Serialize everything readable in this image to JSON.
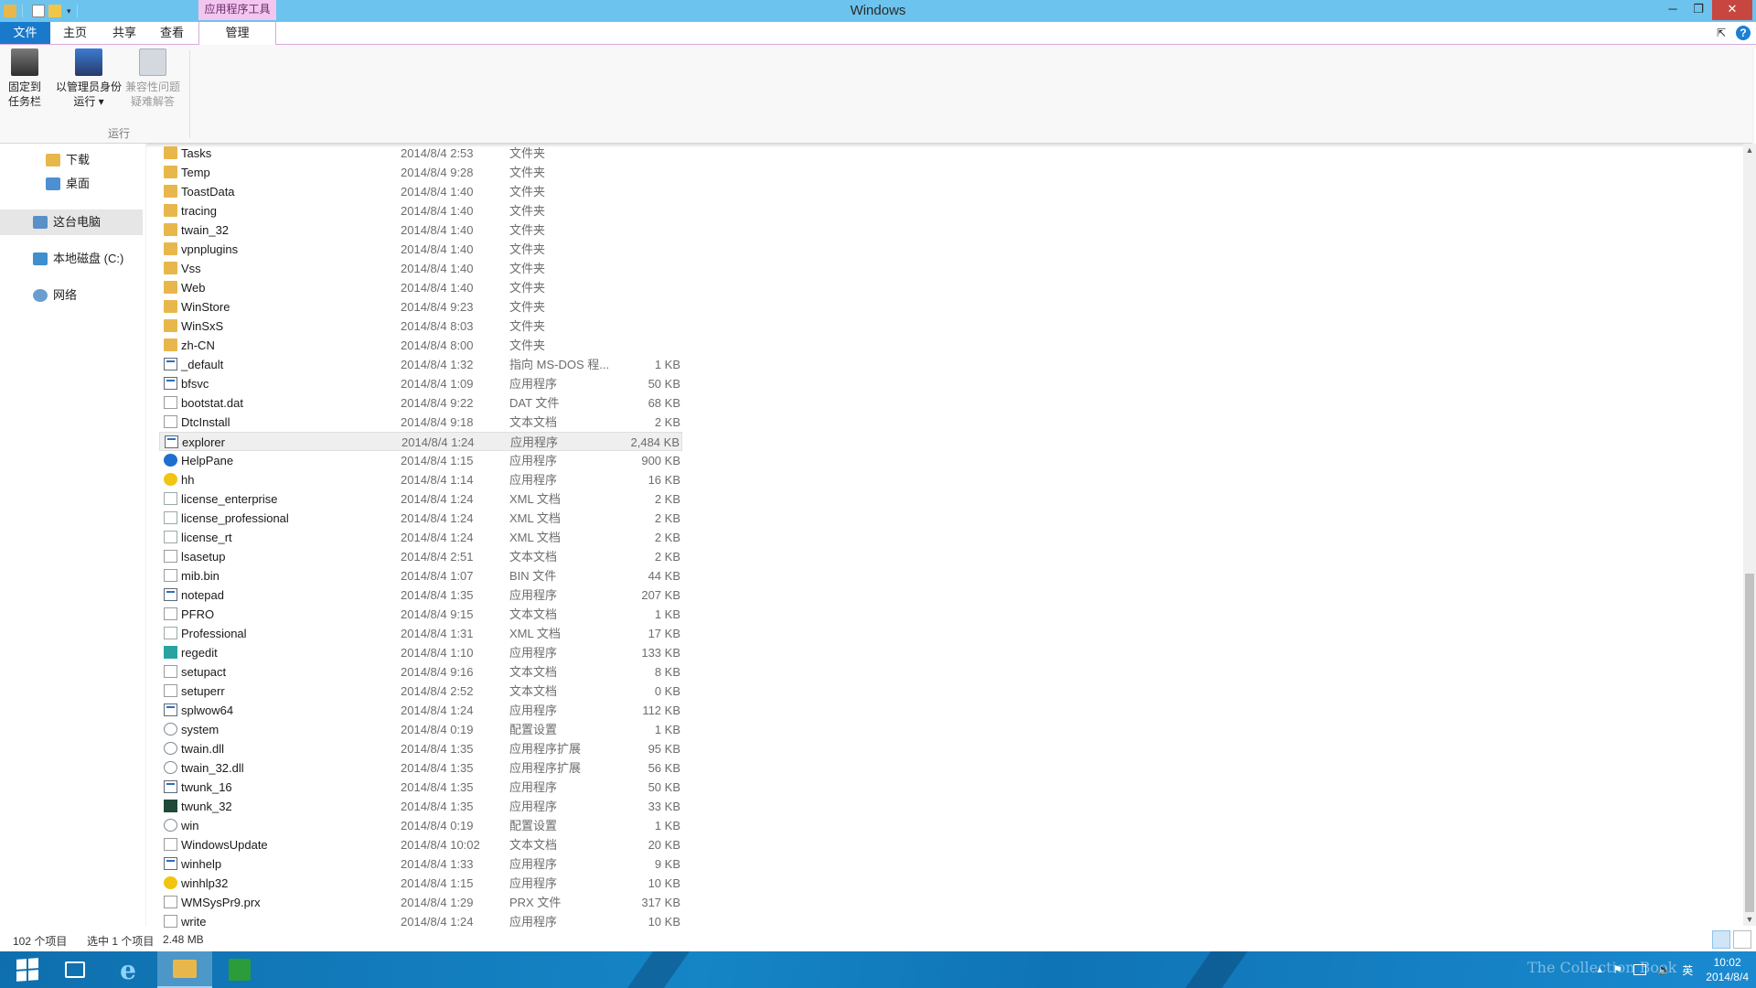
{
  "window": {
    "title": "Windows",
    "context_tab": "应用程序工具",
    "minimize": "─",
    "restore": "❐",
    "close": "✕"
  },
  "ribbon_tabs": {
    "file": "文件",
    "home": "主页",
    "share": "共享",
    "view": "查看",
    "manage": "管理"
  },
  "ribbon": {
    "pin_label": "固定到\n任务栏",
    "run_as_admin_label": "以管理员身份\n运行 ▾",
    "compat_label": "兼容性问题\n疑难解答",
    "group_label": "运行"
  },
  "nav": {
    "downloads": "下载",
    "desktop": "桌面",
    "this_pc": "这台电脑",
    "local_disk": "本地磁盘 (C:)",
    "network": "网络"
  },
  "files": [
    {
      "name": "Tasks",
      "date": "2014/8/4 2:53",
      "type": "文件夹",
      "size": "",
      "icon": "folder-icon"
    },
    {
      "name": "Temp",
      "date": "2014/8/4 9:28",
      "type": "文件夹",
      "size": "",
      "icon": "folder-icon"
    },
    {
      "name": "ToastData",
      "date": "2014/8/4 1:40",
      "type": "文件夹",
      "size": "",
      "icon": "folder-icon"
    },
    {
      "name": "tracing",
      "date": "2014/8/4 1:40",
      "type": "文件夹",
      "size": "",
      "icon": "folder-icon"
    },
    {
      "name": "twain_32",
      "date": "2014/8/4 1:40",
      "type": "文件夹",
      "size": "",
      "icon": "folder-icon"
    },
    {
      "name": "vpnplugins",
      "date": "2014/8/4 1:40",
      "type": "文件夹",
      "size": "",
      "icon": "folder-icon"
    },
    {
      "name": "Vss",
      "date": "2014/8/4 1:40",
      "type": "文件夹",
      "size": "",
      "icon": "folder-icon"
    },
    {
      "name": "Web",
      "date": "2014/8/4 1:40",
      "type": "文件夹",
      "size": "",
      "icon": "folder-icon"
    },
    {
      "name": "WinStore",
      "date": "2014/8/4 9:23",
      "type": "文件夹",
      "size": "",
      "icon": "folder-icon"
    },
    {
      "name": "WinSxS",
      "date": "2014/8/4 8:03",
      "type": "文件夹",
      "size": "",
      "icon": "folder-icon"
    },
    {
      "name": "zh-CN",
      "date": "2014/8/4 8:00",
      "type": "文件夹",
      "size": "",
      "icon": "folder-icon"
    },
    {
      "name": "_default",
      "date": "2014/8/4 1:32",
      "type": "指向 MS-DOS 程...",
      "size": "1 KB",
      "icon": "shortcut-icon"
    },
    {
      "name": "bfsvc",
      "date": "2014/8/4 1:09",
      "type": "应用程序",
      "size": "50 KB",
      "icon": "app-icon"
    },
    {
      "name": "bootstat.dat",
      "date": "2014/8/4 9:22",
      "type": "DAT 文件",
      "size": "68 KB",
      "icon": "file-icon"
    },
    {
      "name": "DtcInstall",
      "date": "2014/8/4 9:18",
      "type": "文本文档",
      "size": "2 KB",
      "icon": "text-file-icon"
    },
    {
      "name": "explorer",
      "date": "2014/8/4 1:24",
      "type": "应用程序",
      "size": "2,484 KB",
      "icon": "explorer-icon"
    },
    {
      "name": "HelpPane",
      "date": "2014/8/4 1:15",
      "type": "应用程序",
      "size": "900 KB",
      "icon": "help-icon"
    },
    {
      "name": "hh",
      "date": "2014/8/4 1:14",
      "type": "应用程序",
      "size": "16 KB",
      "icon": "help-file-icon"
    },
    {
      "name": "license_enterprise",
      "date": "2014/8/4 1:24",
      "type": "XML 文档",
      "size": "2 KB",
      "icon": "xml-icon"
    },
    {
      "name": "license_professional",
      "date": "2014/8/4 1:24",
      "type": "XML 文档",
      "size": "2 KB",
      "icon": "xml-icon"
    },
    {
      "name": "license_rt",
      "date": "2014/8/4 1:24",
      "type": "XML 文档",
      "size": "2 KB",
      "icon": "xml-icon"
    },
    {
      "name": "lsasetup",
      "date": "2014/8/4 2:51",
      "type": "文本文档",
      "size": "2 KB",
      "icon": "text-file-icon"
    },
    {
      "name": "mib.bin",
      "date": "2014/8/4 1:07",
      "type": "BIN 文件",
      "size": "44 KB",
      "icon": "file-icon"
    },
    {
      "name": "notepad",
      "date": "2014/8/4 1:35",
      "type": "应用程序",
      "size": "207 KB",
      "icon": "notepad-icon"
    },
    {
      "name": "PFRO",
      "date": "2014/8/4 9:15",
      "type": "文本文档",
      "size": "1 KB",
      "icon": "text-file-icon"
    },
    {
      "name": "Professional",
      "date": "2014/8/4 1:31",
      "type": "XML 文档",
      "size": "17 KB",
      "icon": "xml-icon"
    },
    {
      "name": "regedit",
      "date": "2014/8/4 1:10",
      "type": "应用程序",
      "size": "133 KB",
      "icon": "regedit-icon"
    },
    {
      "name": "setupact",
      "date": "2014/8/4 9:16",
      "type": "文本文档",
      "size": "8 KB",
      "icon": "text-file-icon"
    },
    {
      "name": "setuperr",
      "date": "2014/8/4 2:52",
      "type": "文本文档",
      "size": "0 KB",
      "icon": "text-file-icon"
    },
    {
      "name": "splwow64",
      "date": "2014/8/4 1:24",
      "type": "应用程序",
      "size": "112 KB",
      "icon": "printer-icon"
    },
    {
      "name": "system",
      "date": "2014/8/4 0:19",
      "type": "配置设置",
      "size": "1 KB",
      "icon": "config-icon"
    },
    {
      "name": "twain.dll",
      "date": "2014/8/4 1:35",
      "type": "应用程序扩展",
      "size": "95 KB",
      "icon": "dll-icon"
    },
    {
      "name": "twain_32.dll",
      "date": "2014/8/4 1:35",
      "type": "应用程序扩展",
      "size": "56 KB",
      "icon": "dll-icon"
    },
    {
      "name": "twunk_16",
      "date": "2014/8/4 1:35",
      "type": "应用程序",
      "size": "50 KB",
      "icon": "app-icon"
    },
    {
      "name": "twunk_32",
      "date": "2014/8/4 1:35",
      "type": "应用程序",
      "size": "33 KB",
      "icon": "app-dark-icon"
    },
    {
      "name": "win",
      "date": "2014/8/4 0:19",
      "type": "配置设置",
      "size": "1 KB",
      "icon": "config-icon"
    },
    {
      "name": "WindowsUpdate",
      "date": "2014/8/4 10:02",
      "type": "文本文档",
      "size": "20 KB",
      "icon": "text-file-icon"
    },
    {
      "name": "winhelp",
      "date": "2014/8/4 1:33",
      "type": "应用程序",
      "size": "9 KB",
      "icon": "app-icon"
    },
    {
      "name": "winhlp32",
      "date": "2014/8/4 1:15",
      "type": "应用程序",
      "size": "10 KB",
      "icon": "key-icon"
    },
    {
      "name": "WMSysPr9.prx",
      "date": "2014/8/4 1:29",
      "type": "PRX 文件",
      "size": "317 KB",
      "icon": "file-icon"
    },
    {
      "name": "write",
      "date": "2014/8/4 1:24",
      "type": "应用程序",
      "size": "10 KB",
      "icon": "write-icon"
    }
  ],
  "highlighted_file": "explorer",
  "status": {
    "item_count": "102 个项目",
    "selected": "选中 1 个项目",
    "selected_size": "2.48 MB"
  },
  "taskbar": {
    "clock_time": "10:02",
    "clock_date": "2014/8/4",
    "watermark": "The Collection Book",
    "tray_arrow": "▲",
    "ime": "英"
  },
  "colors": {
    "title_bar": "#6cc4ee",
    "file_tab": "#1979ca",
    "context_tab": "#f3c6f0",
    "close_button": "#c7463f",
    "taskbar": "#1585c6",
    "folder": "#e8b74b"
  }
}
